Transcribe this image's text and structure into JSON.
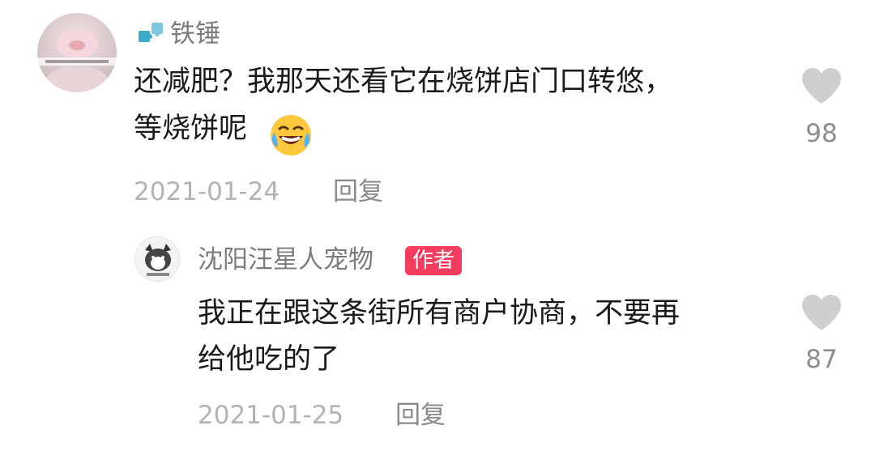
{
  "comments": [
    {
      "username": "铁锤",
      "avatar_icon": "pink-pig-avatar",
      "name_prefix_icon": "puzzle-icon",
      "text_line1": "还减肥？我那天还看它在烧饼店门口转悠，",
      "text_line2": "等烧饼呢",
      "emoji": "laughing-crying-emoji",
      "date": "2021-01-24",
      "reply_label": "回复",
      "like_count": "98"
    },
    {
      "username": "沈阳汪星人宠物",
      "avatar_icon": "husky-logo-avatar",
      "badge": "作者",
      "text_line1": "我正在跟这条街所有商户协商，不要再",
      "text_line2": "给他吃的了",
      "date": "2021-01-25",
      "reply_label": "回复",
      "like_count": "87"
    }
  ],
  "colors": {
    "badge_bg": "#f43c5f",
    "like_heart": "#cfcfcf",
    "username": "#7c7c7c",
    "date": "#b3b3b3"
  }
}
